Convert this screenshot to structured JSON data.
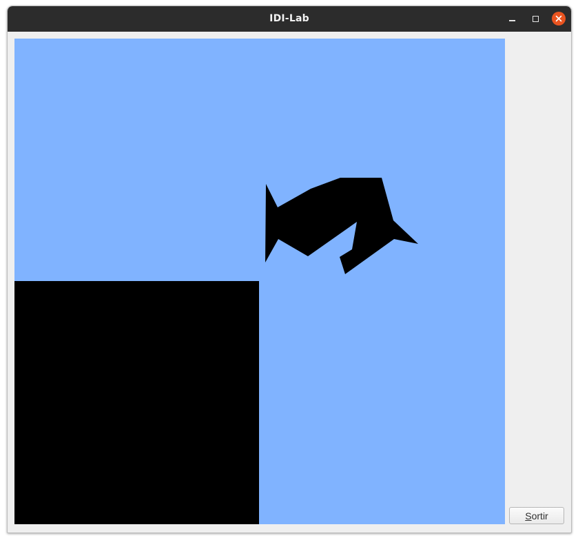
{
  "window": {
    "title": "IDI-Lab",
    "controls": {
      "minimize_icon": "minimize-icon",
      "maximize_icon": "maximize-icon",
      "close_icon": "close-icon"
    }
  },
  "viewport": {
    "background_color": "#80b3ff",
    "shape_color": "#000000"
  },
  "exit_button": {
    "mnemonic": "S",
    "label_rest": "ortir"
  },
  "colors": {
    "titlebar": "#2c2c2c",
    "close_accent": "#e95420",
    "window_bg": "#efefef"
  }
}
